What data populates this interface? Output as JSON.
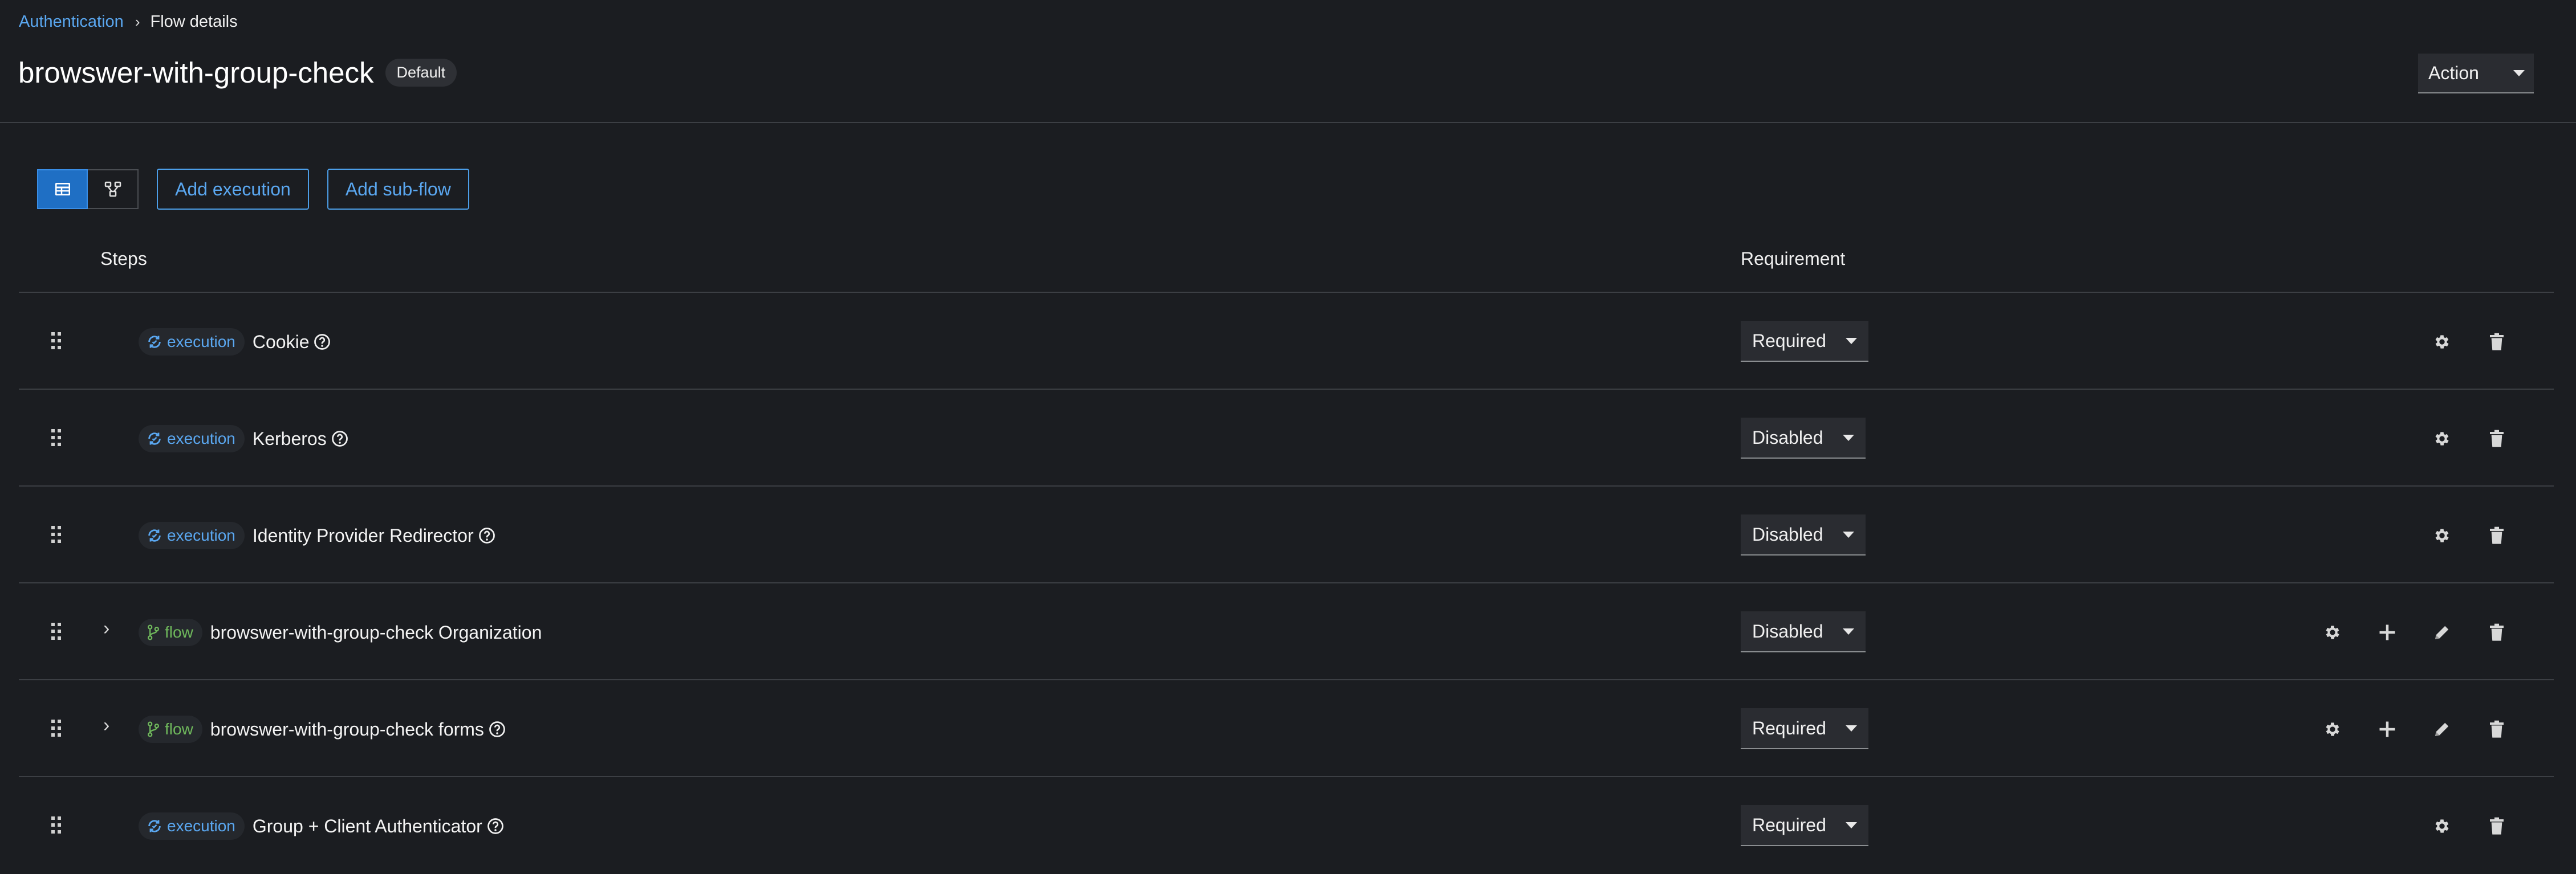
{
  "breadcrumb": {
    "parent": "Authentication",
    "current": "Flow details"
  },
  "header": {
    "title": "browswer-with-group-check",
    "badge": "Default",
    "action_label": "Action"
  },
  "toolbar": {
    "add_execution": "Add execution",
    "add_subflow": "Add sub-flow",
    "view_toggle": [
      "table-view",
      "diagram-view"
    ]
  },
  "table": {
    "col_steps": "Steps",
    "col_requirement": "Requirement",
    "rows": [
      {
        "type": "execution",
        "name": "Cookie",
        "help": true,
        "requirement": "Required",
        "expandable": false
      },
      {
        "type": "execution",
        "name": "Kerberos",
        "help": true,
        "requirement": "Disabled",
        "expandable": false
      },
      {
        "type": "execution",
        "name": "Identity Provider Redirector",
        "help": true,
        "requirement": "Disabled",
        "expandable": false
      },
      {
        "type": "flow",
        "name": "browswer-with-group-check Organization",
        "help": false,
        "requirement": "Disabled",
        "expandable": true
      },
      {
        "type": "flow",
        "name": "browswer-with-group-check forms",
        "help": true,
        "requirement": "Required",
        "expandable": true
      },
      {
        "type": "execution",
        "name": "Group + Client Authenticator",
        "help": true,
        "requirement": "Required",
        "expandable": false
      }
    ]
  },
  "colors": {
    "background": "#1b1d21",
    "link": "#5aa7f0",
    "execution": "#5aa7f0",
    "flow": "#6fb85c",
    "active_toggle": "#1f6fc4"
  }
}
